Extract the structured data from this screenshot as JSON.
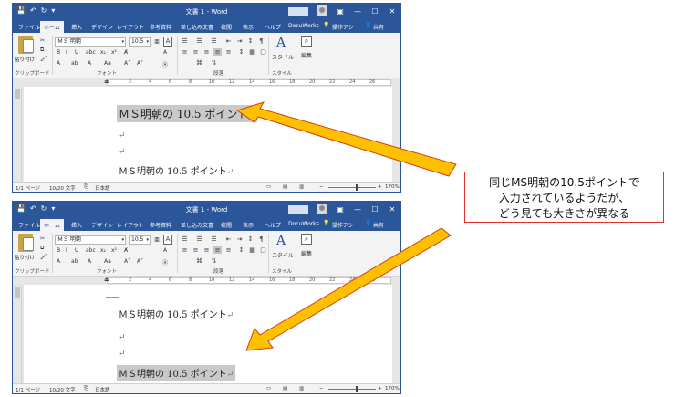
{
  "windows": [
    {
      "id": "top",
      "title": "文書 1  -  Word",
      "tabs": [
        "ファイル",
        "ホーム",
        "挿入",
        "デザイン",
        "レイアウト",
        "参考資料",
        "差し込み文書",
        "校閲",
        "表示",
        "ヘルプ",
        "DocuWorks",
        "操作アシ",
        "共有"
      ],
      "active_tab": "ホーム",
      "ribbon": {
        "paste_label": "貼り付け",
        "clipboard_label": "クリップボード",
        "font_label": "フォント",
        "paragraph_label": "段落",
        "style_btn_label": "スタイル",
        "style_label": "スタイル",
        "edit_label": "編集",
        "font_name": "ＭＳ 明朝",
        "font_size": "10.5"
      },
      "doc_lines": [
        {
          "text": "ＭＳ明朝の 10.5 ポイント",
          "highlighted": true,
          "size": "big"
        },
        {
          "text": "",
          "highlighted": false,
          "size": "small"
        },
        {
          "text": "",
          "highlighted": false,
          "size": "small"
        },
        {
          "text": "ＭＳ明朝の 10.5 ポイント",
          "highlighted": false,
          "size": "small"
        }
      ],
      "status": {
        "page": "1/1 ページ",
        "words": "10/20 文字",
        "lang": "日本語",
        "zoom": "170%"
      }
    },
    {
      "id": "bottom",
      "title": "文書 1  -  Word",
      "tabs": [
        "ファイル",
        "ホーム",
        "挿入",
        "デザイン",
        "レイアウト",
        "参考資料",
        "差し込み文書",
        "校閲",
        "表示",
        "ヘルプ",
        "DocuWorks",
        "操作アシ",
        "共有"
      ],
      "active_tab": "ホーム",
      "ribbon": {
        "paste_label": "貼り付け",
        "clipboard_label": "クリップボード",
        "font_label": "フォント",
        "paragraph_label": "段落",
        "style_btn_label": "スタイル",
        "style_label": "スタイル",
        "edit_label": "編集",
        "font_name": "ＭＳ 明朝",
        "font_size": "10.5"
      },
      "doc_lines": [
        {
          "text": "ＭＳ明朝の 10.5 ポイント",
          "highlighted": false,
          "size": "small"
        },
        {
          "text": "",
          "highlighted": false,
          "size": "small"
        },
        {
          "text": "",
          "highlighted": false,
          "size": "small"
        },
        {
          "text": "ＭＳ明朝の 10.5 ポイント",
          "highlighted": true,
          "size": "small"
        }
      ],
      "status": {
        "page": "1/1 ページ",
        "words": "10/20 文字",
        "lang": "日本語",
        "zoom": "170%"
      }
    }
  ],
  "ruler_ticks": [
    "2",
    "4",
    "6",
    "8",
    "10",
    "12",
    "14",
    "16",
    "18",
    "20",
    "22",
    "24",
    "26"
  ],
  "callout": {
    "lines": [
      "同じMS明朝の10.5ポイントで",
      "入力されているようだが、",
      "どう見ても大きさが異なる"
    ]
  },
  "colors": {
    "word_blue": "#2b579a",
    "arrow_fill": "#ffc000",
    "arrow_stroke": "#d04010",
    "callout_border": "#e03030"
  }
}
